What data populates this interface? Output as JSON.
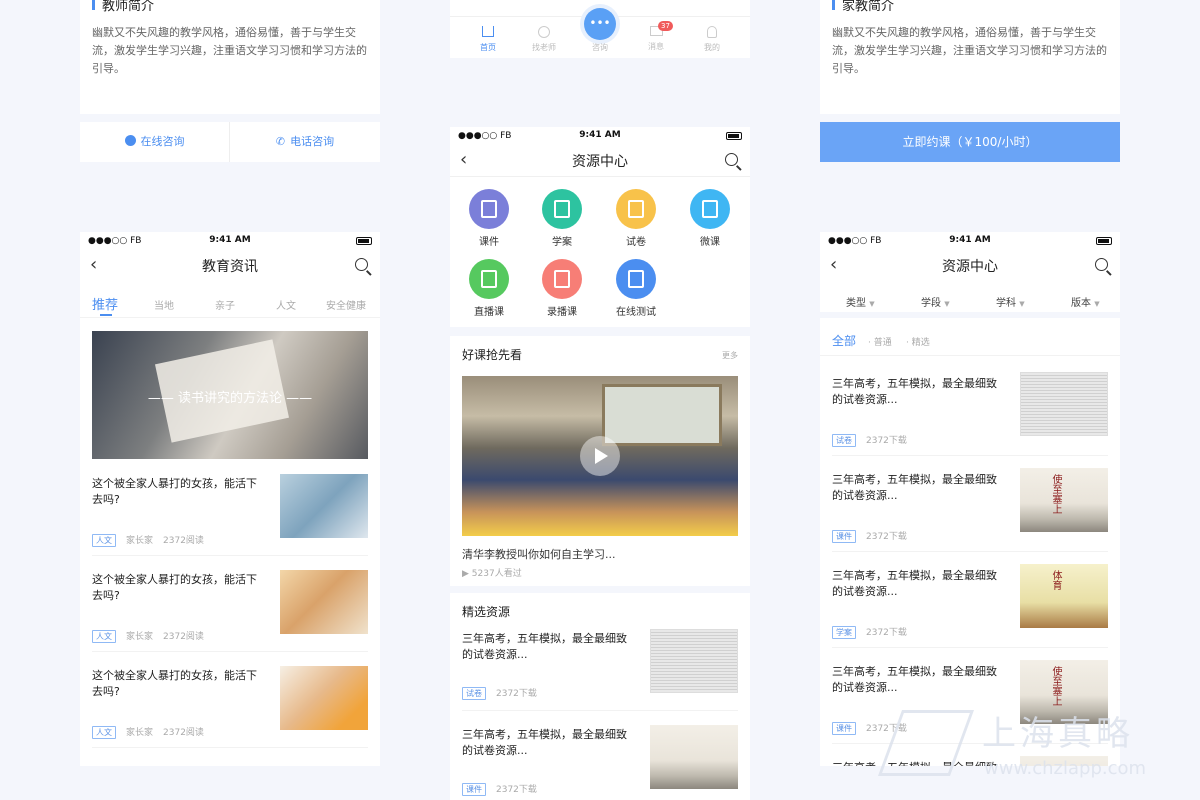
{
  "top_left": {
    "section_title": "教师简介",
    "desc": "幽默又不失风趣的教学风格，通俗易懂，善于与学生交流，激发学生学习兴趣，注重语文学习习惯和学习方法的引导。",
    "online_btn": "在线咨询",
    "phone_btn": "电话咨询"
  },
  "top_center": {
    "tabs": [
      {
        "label": "首页"
      },
      {
        "label": "找老师"
      },
      {
        "label": "咨询"
      },
      {
        "label": "消息",
        "badge": "37"
      },
      {
        "label": "我的"
      }
    ]
  },
  "top_right": {
    "section_title": "家教简介",
    "desc": "幽默又不失风趣的教学风格，通俗易懂，善于与学生交流，激发学生学习兴趣，注重语文学习习惯和学习方法的引导。",
    "book_btn": "立即约课（￥100/小时）"
  },
  "status": {
    "signal": "●●●○○ FB",
    "time": "9:41 AM"
  },
  "news": {
    "title": "教育资讯",
    "tabs": [
      "推荐",
      "当地",
      "亲子",
      "人文",
      "安全健康"
    ],
    "banner_text": "—— 读书讲究的方法论 ——",
    "items": [
      {
        "title": "这个被全家人暴打的女孩，能活下去吗?",
        "tag": "人文",
        "author": "家长家",
        "reads": "2372阅读"
      },
      {
        "title": "这个被全家人暴打的女孩，能活下去吗?",
        "tag": "人文",
        "author": "家长家",
        "reads": "2372阅读"
      },
      {
        "title": "这个被全家人暴打的女孩，能活下去吗?",
        "tag": "人文",
        "author": "家长家",
        "reads": "2372阅读"
      }
    ]
  },
  "resource": {
    "title": "资源中心",
    "grid": [
      {
        "label": "课件",
        "color": "#7b7fd9",
        "icon": "courseware-icon"
      },
      {
        "label": "学案",
        "color": "#2dc3a0",
        "icon": "case-icon"
      },
      {
        "label": "试卷",
        "color": "#f8c24a",
        "icon": "paper-icon"
      },
      {
        "label": "微课",
        "color": "#3fb6f3",
        "icon": "microlesson-icon"
      },
      {
        "label": "直播课",
        "color": "#56c95f",
        "icon": "live-icon"
      },
      {
        "label": "录播课",
        "color": "#f77e76",
        "icon": "recorded-icon"
      },
      {
        "label": "在线测试",
        "color": "#4b8ef0",
        "icon": "test-icon"
      }
    ],
    "featured_title": "好课抢先看",
    "featured_more": "更多",
    "video_title": "清华李教授叫你如何自主学习...",
    "video_views": "5237人看过",
    "selected_title": "精选资源",
    "items": [
      {
        "title": "三年高考，五年模拟，最全最细致的试卷资源...",
        "tag": "试卷",
        "downloads": "2372下载"
      },
      {
        "title": "三年高考，五年模拟，最全最细致的试卷资源...",
        "tag": "课件",
        "downloads": "2372下载"
      }
    ]
  },
  "resource_right": {
    "title": "资源中心",
    "filters": [
      "类型",
      "学段",
      "学科",
      "版本"
    ],
    "sub_tabs": [
      "全部",
      "普通",
      "精选"
    ],
    "items": [
      {
        "title": "三年高考，五年模拟，最全最细致的试卷资源...",
        "tag": "试卷",
        "downloads": "2372下载",
        "thumb": "doc"
      },
      {
        "title": "三年高考，五年模拟，最全最细致的试卷资源...",
        "tag": "课件",
        "downloads": "2372下载",
        "thumb": "ink",
        "thumb_text": "使至塞上"
      },
      {
        "title": "三年高考，五年模拟，最全最细致的试卷资源...",
        "tag": "学案",
        "downloads": "2372下载",
        "thumb": "yellow",
        "thumb_text": "体育"
      },
      {
        "title": "三年高考，五年模拟，最全最细致的试卷资源...",
        "tag": "课件",
        "downloads": "2372下载",
        "thumb": "ink",
        "thumb_text": "使至塞上"
      },
      {
        "title": "三年高考，五年模拟，最全最细致的试卷资源...",
        "tag": "",
        "downloads": "",
        "thumb": "ink"
      }
    ]
  },
  "watermark": {
    "text": "上海真略",
    "url": "www.chzlapp.com"
  }
}
